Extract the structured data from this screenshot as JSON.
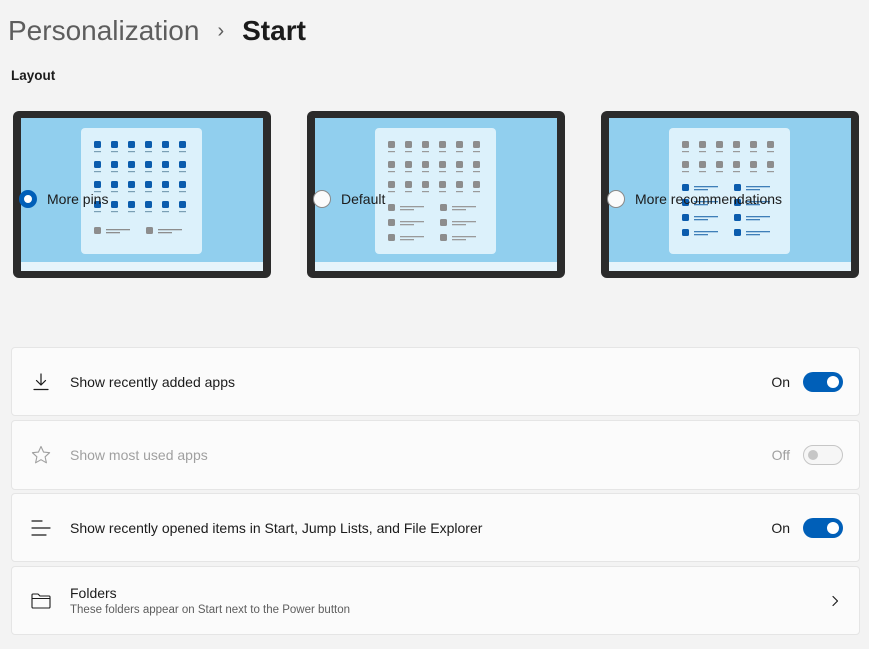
{
  "breadcrumb": {
    "parent": "Personalization",
    "separator": "›",
    "current": "Start"
  },
  "layout_section": {
    "title": "Layout",
    "options": [
      {
        "label": "More pins",
        "selected": true
      },
      {
        "label": "Default",
        "selected": false
      },
      {
        "label": "More recommendations",
        "selected": false
      }
    ]
  },
  "settings": {
    "recently_added": {
      "label": "Show recently added apps",
      "state": "On",
      "enabled": true,
      "icon": "download-icon"
    },
    "most_used": {
      "label": "Show most used apps",
      "state": "Off",
      "enabled": false,
      "icon": "star-icon"
    },
    "recently_opened": {
      "label": "Show recently opened items in Start, Jump Lists, and File Explorer",
      "state": "On",
      "enabled": true,
      "icon": "list-icon"
    },
    "folders": {
      "title": "Folders",
      "subtitle": "These folders appear on Start next to the Power button",
      "icon": "folder-icon"
    }
  },
  "colors": {
    "accent": "#005fb8",
    "screen": "#91cfee",
    "start_menu": "#dcf1fb",
    "pin_active": "#0b5cad",
    "pin_inactive": "#8d8d8d"
  }
}
